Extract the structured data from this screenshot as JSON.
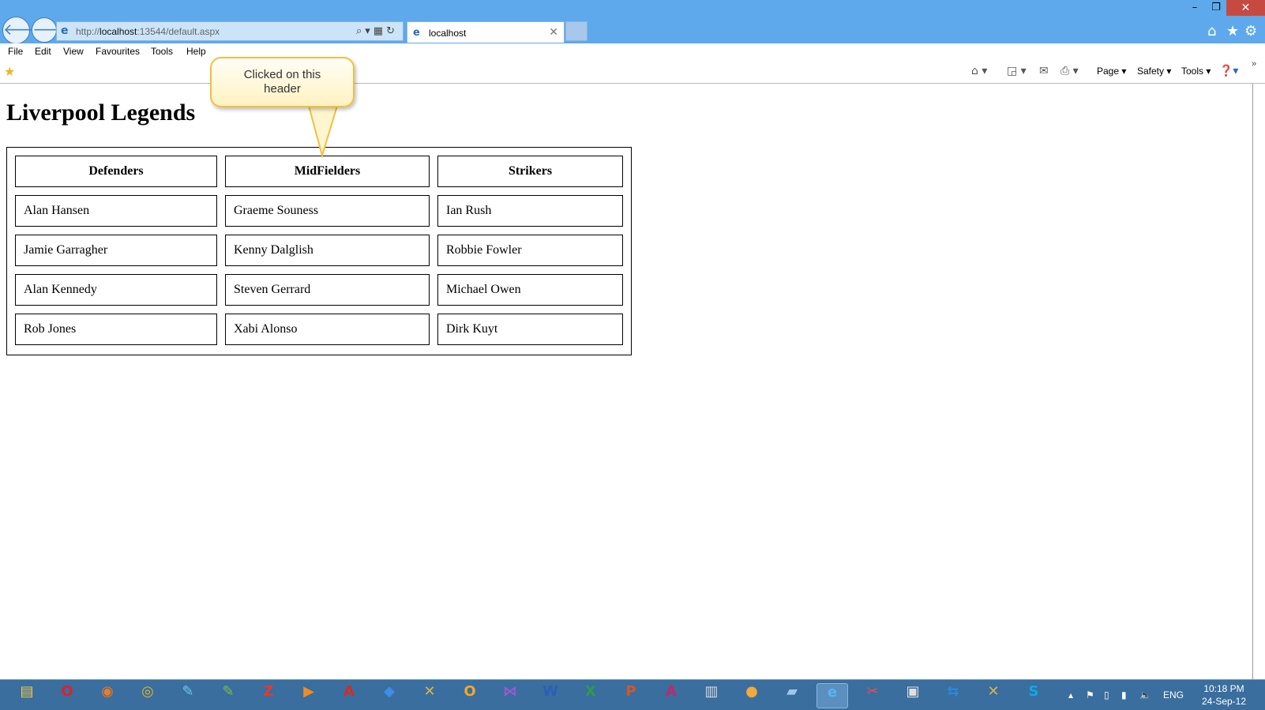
{
  "browser": {
    "address": {
      "prefix": "http://",
      "host": "localhost",
      "rest": ":13544/default.aspx"
    },
    "tab_title": "localhost",
    "menu": [
      "File",
      "Edit",
      "View",
      "Favourites",
      "Tools",
      "Help"
    ],
    "commands": {
      "page": "Page ▾",
      "safety": "Safety ▾",
      "tools": "Tools ▾"
    }
  },
  "page": {
    "title": "Liverpool Legends",
    "headers": [
      "Defenders",
      "MidFielders",
      "Strikers"
    ],
    "rows": [
      [
        "Alan Hansen",
        "Graeme Souness",
        "Ian Rush"
      ],
      [
        "Jamie Garragher",
        "Kenny Dalglish",
        "Robbie Fowler"
      ],
      [
        "Alan Kennedy",
        "Steven Gerrard",
        "Michael Owen"
      ],
      [
        "Rob Jones",
        "Xabi Alonso",
        "Dirk Kuyt"
      ]
    ]
  },
  "annotation": {
    "line1": "Clicked on this",
    "line2": "header"
  },
  "taskbar": {
    "apps": [
      {
        "name": "file-explorer-icon",
        "glyph": "▤",
        "color": "#f2c94c"
      },
      {
        "name": "opera-icon",
        "glyph": "O",
        "color": "#e0202a"
      },
      {
        "name": "firefox-icon",
        "glyph": "◉",
        "color": "#f07a1d"
      },
      {
        "name": "chrome-icon",
        "glyph": "◎",
        "color": "#e8b71a"
      },
      {
        "name": "paint-icon",
        "glyph": "✎",
        "color": "#6fc8ef"
      },
      {
        "name": "notepad-icon",
        "glyph": "✎",
        "color": "#7bc043"
      },
      {
        "name": "filezilla-icon",
        "glyph": "Z",
        "color": "#e23b2e"
      },
      {
        "name": "media-player-icon",
        "glyph": "▶",
        "color": "#f28b20"
      },
      {
        "name": "acrobat-icon",
        "glyph": "A",
        "color": "#d62a25"
      },
      {
        "name": "dropbox-icon",
        "glyph": "◆",
        "color": "#3d8ee6"
      },
      {
        "name": "tools-icon",
        "glyph": "✕",
        "color": "#d9b548"
      },
      {
        "name": "outlook-icon",
        "glyph": "O",
        "color": "#f0a830"
      },
      {
        "name": "visual-studio-icon",
        "glyph": "⋈",
        "color": "#9b59d0"
      },
      {
        "name": "word-icon",
        "glyph": "W",
        "color": "#2b5fb3"
      },
      {
        "name": "excel-icon",
        "glyph": "X",
        "color": "#2f9a4b"
      },
      {
        "name": "powerpoint-icon",
        "glyph": "P",
        "color": "#d8542b"
      },
      {
        "name": "access-icon",
        "glyph": "A",
        "color": "#c0286b"
      },
      {
        "name": "control-panel-icon",
        "glyph": "▥",
        "color": "#d8d8d8"
      },
      {
        "name": "palette-icon",
        "glyph": "●",
        "color": "#f3a93b"
      },
      {
        "name": "network-icon",
        "glyph": "▰",
        "color": "#9ec8ea"
      },
      {
        "name": "internet-explorer-icon",
        "glyph": "e",
        "color": "#58b4f0"
      },
      {
        "name": "snipping-icon",
        "glyph": "✂",
        "color": "#e8504a"
      },
      {
        "name": "remote-desktop-icon",
        "glyph": "▣",
        "color": "#e0e0e0"
      },
      {
        "name": "teamviewer-icon",
        "glyph": "⇆",
        "color": "#2a8bdc"
      },
      {
        "name": "build-tools-icon",
        "glyph": "✕",
        "color": "#d9b548"
      },
      {
        "name": "skype-icon",
        "glyph": "S",
        "color": "#16a6e6"
      }
    ],
    "language": "ENG",
    "time": "10:18 PM",
    "date": "24-Sep-12"
  }
}
